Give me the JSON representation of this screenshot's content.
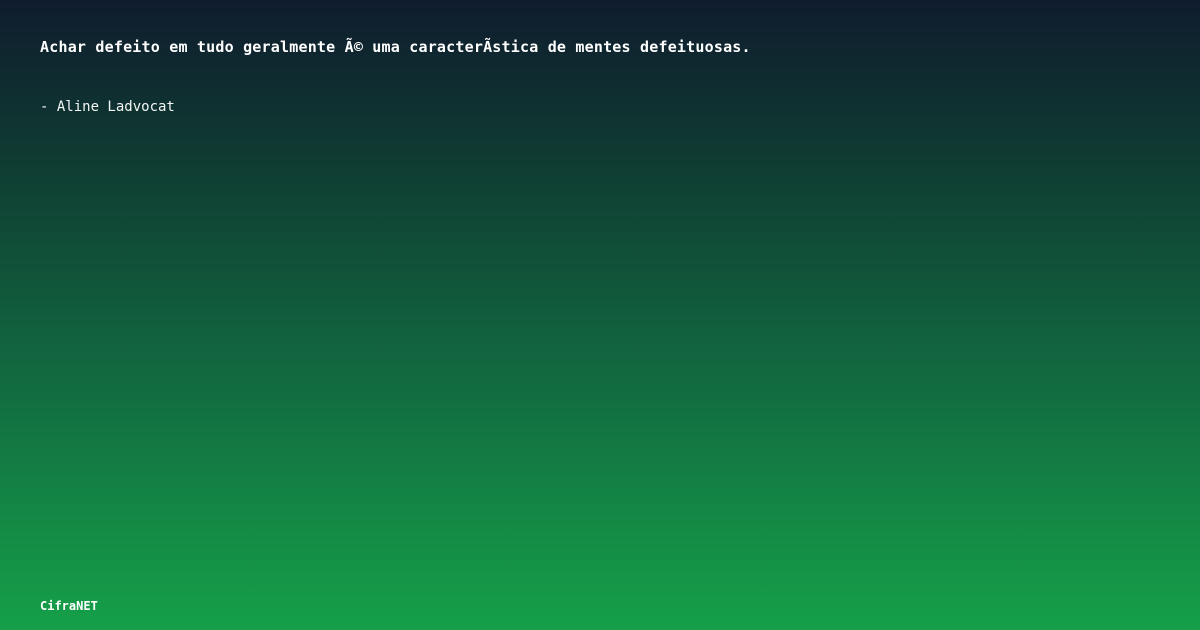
{
  "quote": {
    "text": "Achar defeito em tudo geralmente Ã© uma caracterÃ­stica de mentes defeituosas.",
    "author": "- Aline Ladvocat"
  },
  "brand": {
    "name": "CifraNET"
  }
}
